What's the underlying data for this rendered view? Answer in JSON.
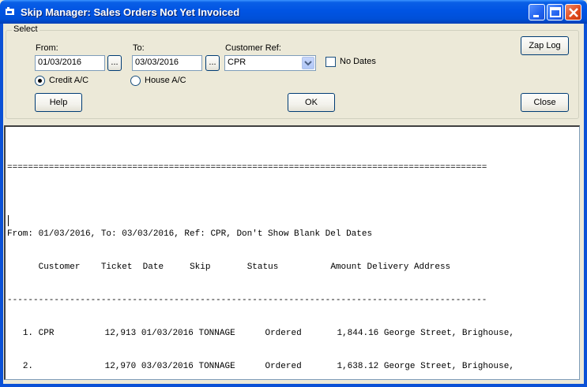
{
  "window": {
    "title": "Skip Manager: Sales Orders Not Yet Invoiced"
  },
  "select_group": {
    "label": "Select",
    "from_label": "From:",
    "from_value": "01/03/2016",
    "from_picker": "...",
    "to_label": "To:",
    "to_value": "03/03/2016",
    "to_picker": "...",
    "customer_ref_label": "Customer Ref:",
    "customer_ref_value": "CPR",
    "no_dates_label": "No Dates",
    "no_dates_checked": false,
    "credit_label": "Credit A/C",
    "house_label": "House A/C",
    "selected_account": "Credit A/C"
  },
  "buttons": {
    "zap_log": "Zap Log",
    "help": "Help",
    "ok": "OK",
    "close": "Close"
  },
  "report": {
    "rule_double": "============================================================================================",
    "criteria": "From: 01/03/2016, To: 03/03/2016, Ref: CPR, Don't Show Blank Del Dates",
    "columns": [
      "Customer",
      "Ticket",
      "Date",
      "Skip",
      "Status",
      "Amount",
      "Delivery Address"
    ],
    "rule_single": "--------------------------------------------------------------------------------------------",
    "rows": [
      {
        "num": "1.",
        "customer": "CPR",
        "ticket": "12,913",
        "date": "01/03/2016",
        "skip": "TONNAGE",
        "status": "Ordered",
        "amount": "1,844.16",
        "address": "George Street, Brighouse,"
      },
      {
        "num": "2.",
        "customer": "",
        "ticket": "12,970",
        "date": "03/03/2016",
        "skip": "TONNAGE",
        "status": "Ordered",
        "amount": "1,638.12",
        "address": "George Street, Brighouse,"
      }
    ]
  },
  "colors": {
    "titlebar": "#0054e3",
    "window_bg": "#ece9d8"
  }
}
